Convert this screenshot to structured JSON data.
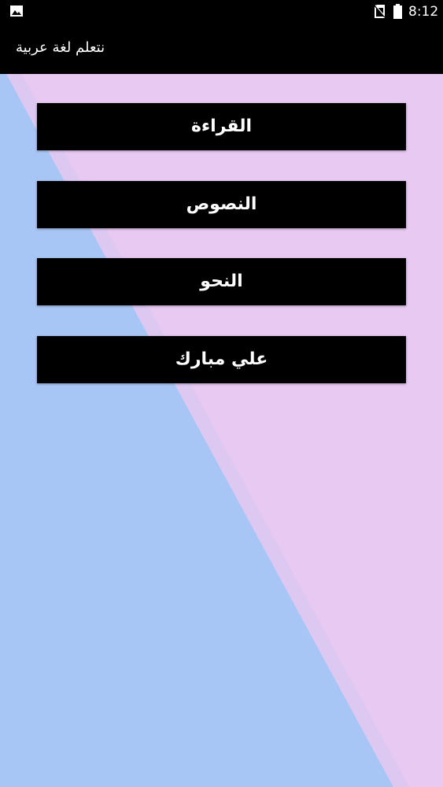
{
  "status_bar": {
    "time": "8:12",
    "icons": [
      "image-notification-icon",
      "no-sim-icon",
      "battery-icon"
    ]
  },
  "app_bar": {
    "title": "نتعلم لغة عربية"
  },
  "menu": {
    "items": [
      {
        "label": "القراءة"
      },
      {
        "label": "النصوص"
      },
      {
        "label": "النحو"
      },
      {
        "label": "علي مبارك"
      }
    ]
  },
  "colors": {
    "background_blue": "#a8c6f5",
    "background_pink": "#e8c9f2",
    "button_bg": "#000000",
    "button_text": "#ffffff"
  }
}
